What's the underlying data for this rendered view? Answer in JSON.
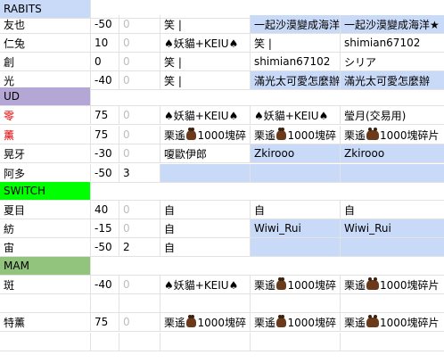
{
  "colors": {
    "rabits": "#c9daf8",
    "ud": "#b4a7d6",
    "switch": "#00ff00",
    "mam": "#93c47d",
    "highlight": "#c9daf8",
    "red_text": "#e00000"
  },
  "icon": "bag-icon",
  "rows": [
    {
      "type": "header",
      "label": "RABITS",
      "color": "rabits"
    },
    {
      "type": "data",
      "name": "友也",
      "num": "-50",
      "extra": "0",
      "c3": "笑 |",
      "c4": "一起沙漠變成海洋",
      "c5": "一起沙漠變成海洋★",
      "blue": [
        4,
        5
      ]
    },
    {
      "type": "data",
      "name": "仁兔",
      "num": "10",
      "extra": "0",
      "c3": "♠妖貓+KEIU♠",
      "c4": "笑 |",
      "c5": "shimian67102"
    },
    {
      "type": "data",
      "name": "創",
      "num": "0",
      "extra": "0",
      "c3": "笑 |",
      "c4": "shimian67102",
      "c5": "シリア"
    },
    {
      "type": "data",
      "name": "光",
      "num": "-40",
      "extra": "0",
      "c3": "笑 |",
      "c4": "滿光太可愛怎麼辦",
      "c5": "滿光太可愛怎麼辦",
      "blue": [
        4,
        5
      ]
    },
    {
      "type": "header",
      "label": "UD",
      "color": "ud"
    },
    {
      "type": "data",
      "name": "零",
      "name_red": true,
      "num": "75",
      "extra": "0",
      "c3": "♠妖貓+KEIU♠",
      "c4": "♠妖貓+KEIU♠",
      "c5": "瑩月(交易用)"
    },
    {
      "type": "data",
      "name": "薰",
      "name_red": true,
      "num": "75",
      "extra": "0",
      "c3": "栗遙 [bag] 1000塊碎",
      "c4": "栗遙 [bag] 1000塊碎",
      "c5": "栗遙 [bag] 1000塊碎片"
    },
    {
      "type": "data",
      "name": "晃牙",
      "num": "-30",
      "extra": "0",
      "c3": "嗄歐伊郎",
      "c4": "Zkirooo",
      "c5": "Zkirooo",
      "blue": [
        4,
        5
      ]
    },
    {
      "type": "data",
      "name": "阿多",
      "num": "-50",
      "extra": "3",
      "extra_dark": true,
      "c3": "",
      "c4": "",
      "c5": "",
      "blue": [
        3,
        4,
        5
      ]
    },
    {
      "type": "header",
      "label": "SWITCH",
      "color": "switch"
    },
    {
      "type": "data",
      "name": "夏目",
      "num": "40",
      "extra": "0",
      "c3": "自",
      "c4": "自",
      "c5": "自"
    },
    {
      "type": "data",
      "name": "紡",
      "num": "-15",
      "extra": "0",
      "c3": "自",
      "c4": "Wiwi_Rui",
      "c5": "Wiwi_Rui",
      "blue": [
        4,
        5
      ]
    },
    {
      "type": "data",
      "name": "宙",
      "num": "-50",
      "extra": "2",
      "extra_dark": true,
      "c3": "自",
      "c4": "",
      "c5": "",
      "blue": [
        4,
        5
      ]
    },
    {
      "type": "header",
      "label": "MAM",
      "color": "mam"
    },
    {
      "type": "data",
      "name": "斑",
      "num": "-40",
      "extra": "0",
      "c3": "♠妖貓+KEIU♠",
      "c4": "栗遙 [bag] 1000塊碎",
      "c5": "栗遙 [bag] 1000塊碎片"
    },
    {
      "type": "empty"
    },
    {
      "type": "data",
      "name": "特薰",
      "num": "75",
      "extra": "0",
      "c3": "栗遙 [bag] 1000塊碎",
      "c4": "栗遙 [bag] 1000塊碎",
      "c5": "栗遙 [bag] 1000塊碎片"
    },
    {
      "type": "empty"
    }
  ]
}
